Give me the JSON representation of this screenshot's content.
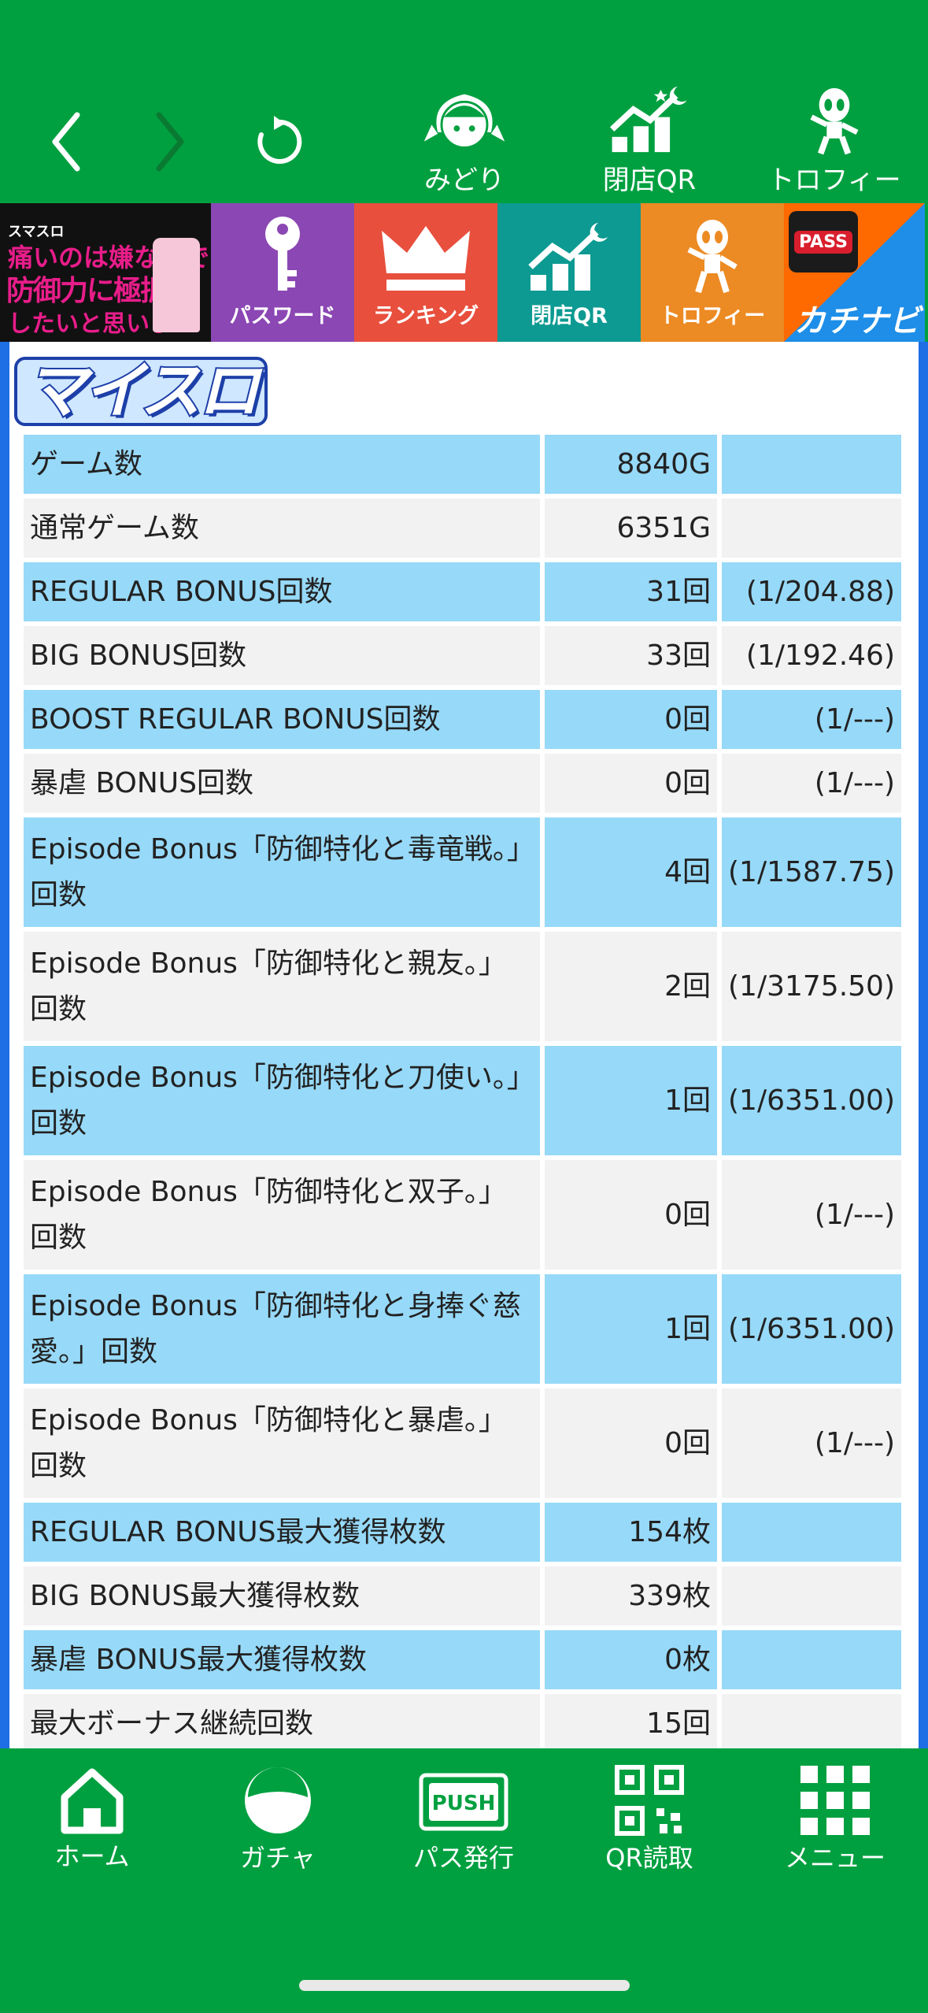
{
  "top_nav": {
    "back_icon": "chevron-left-icon",
    "forward_icon": "chevron-right-icon",
    "reload_icon": "reload-icon",
    "items": [
      {
        "label": "みどり",
        "icon": "midori-character-icon"
      },
      {
        "label": "閉店QR",
        "icon": "chart-moon-icon"
      },
      {
        "label": "トロフィー",
        "icon": "alien-trophy-icon"
      }
    ]
  },
  "banner": {
    "promo": {
      "line1": "スマスロ",
      "line2": "痛いのは嫌なので",
      "line3": "防御力に極振り",
      "line4": "したいと思います。"
    },
    "tiles": [
      {
        "label": "パスワード",
        "icon": "key-icon"
      },
      {
        "label": "ランキング",
        "icon": "crown-icon"
      },
      {
        "label": "閉店QR",
        "icon": "chart-moon-icon"
      },
      {
        "label": "トロフィー",
        "icon": "alien-trophy-icon"
      }
    ],
    "kachi": {
      "pass_label": "PASS",
      "text": "カチナビ"
    }
  },
  "logo_text": "マイスロ",
  "stats": [
    {
      "name": "ゲーム数",
      "value": "8840G",
      "rate": "",
      "style": "blue"
    },
    {
      "name": "通常ゲーム数",
      "value": "6351G",
      "rate": "",
      "style": "gray"
    },
    {
      "name": "REGULAR BONUS回数",
      "value": "31回",
      "rate": "(1/204.88)",
      "style": "blue"
    },
    {
      "name": "BIG BONUS回数",
      "value": "33回",
      "rate": "(1/192.46)",
      "style": "gray"
    },
    {
      "name": "BOOST REGULAR BONUS回数",
      "value": "0回",
      "rate": "(1/---)",
      "style": "blue"
    },
    {
      "name": "暴虐 BONUS回数",
      "value": "0回",
      "rate": "(1/---)",
      "style": "gray"
    },
    {
      "name": "Episode Bonus「防御特化と毒竜戦。」回数",
      "value": "4回",
      "rate": "(1/1587.75)",
      "style": "blue"
    },
    {
      "name": "Episode Bonus「防御特化と親友。」回数",
      "value": "2回",
      "rate": "(1/3175.50)",
      "style": "gray"
    },
    {
      "name": "Episode Bonus「防御特化と刀使い。」回数",
      "value": "1回",
      "rate": "(1/6351.00)",
      "style": "blue"
    },
    {
      "name": "Episode Bonus「防御特化と双子。」回数",
      "value": "0回",
      "rate": "(1/---)",
      "style": "gray"
    },
    {
      "name": "Episode Bonus「防御特化と身捧ぐ慈愛。」回数",
      "value": "1回",
      "rate": "(1/6351.00)",
      "style": "blue"
    },
    {
      "name": "Episode Bonus「防御特化と暴虐。」回数",
      "value": "0回",
      "rate": "(1/---)",
      "style": "gray"
    },
    {
      "name": "REGULAR BONUS最大獲得枚数",
      "value": "154枚",
      "rate": "",
      "style": "blue"
    },
    {
      "name": "BIG BONUS最大獲得枚数",
      "value": "339枚",
      "rate": "",
      "style": "gray"
    },
    {
      "name": "暴虐 BONUS最大獲得枚数",
      "value": "0枚",
      "rate": "",
      "style": "blue"
    },
    {
      "name": "最大ボーナス継続回数",
      "value": "15回",
      "rate": "",
      "style": "gray"
    }
  ],
  "bottom_nav": [
    {
      "label": "ホーム",
      "icon": "home-icon"
    },
    {
      "label": "ガチャ",
      "icon": "gacha-ball-icon"
    },
    {
      "label": "パス発行",
      "icon": "push-pass-icon"
    },
    {
      "label": "QR読取",
      "icon": "qr-code-icon"
    },
    {
      "label": "メニュー",
      "icon": "grid-menu-icon"
    }
  ],
  "colors": {
    "brand_green": "#00a040",
    "row_blue": "#97d9f8",
    "row_gray": "#f2f2f2",
    "frame_blue": "#1e6fe5"
  }
}
